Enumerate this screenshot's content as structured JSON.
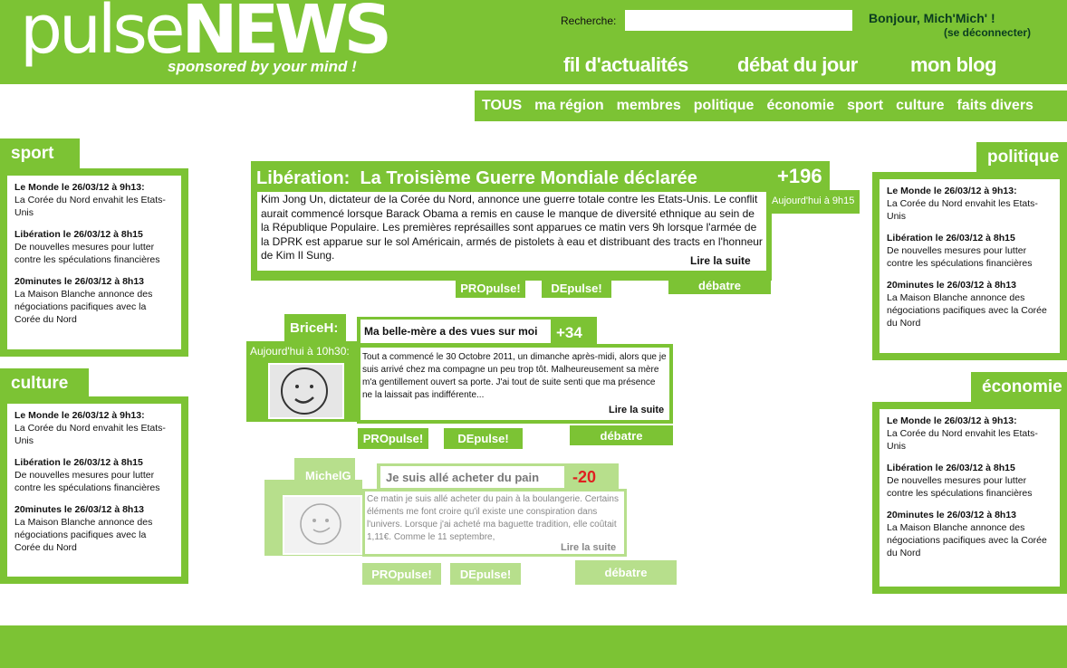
{
  "header": {
    "logo_light": "pulse",
    "logo_bold": "NEWS",
    "tagline": "sponsored by your mind !",
    "search_label": "Recherche:",
    "search_value": "",
    "greeting": "Bonjour, Mich'Mich' !",
    "logout": "(se déconnecter)"
  },
  "nav": [
    "fil d'actualités",
    "débat du jour",
    "mon blog"
  ],
  "categories": [
    "TOUS",
    "ma région",
    "membres",
    "politique",
    "économie",
    "sport",
    "culture",
    "faits divers"
  ],
  "panel_items": [
    {
      "source": "Le Monde le 26/03/12 à 9h13:",
      "text": "La Corée du Nord envahit les Etats-Unis"
    },
    {
      "source": "Libération le 26/03/12 à 8h15",
      "text": "De nouvelles mesures pour lutter contre les spéculations financières"
    },
    {
      "source": "20minutes le 26/03/12 à 8h13",
      "text": "La Maison Blanche annonce des négociations pacifiques avec la Corée du Nord"
    }
  ],
  "panels": {
    "sport": "sport",
    "culture": "culture",
    "politique": "politique",
    "economie": "économie"
  },
  "article1": {
    "source": "Libération:",
    "title": "La Troisième Guerre Mondiale déclarée",
    "score": "+196",
    "time": "Aujourd'hui à 9h15",
    "body": "Kim Jong Un, dictateur de la Corée du Nord, annonce une guerre totale contre les Etats-Unis. Le conflit aurait commencé lorsque Barack Obama a remis en cause le manque de diversité ethnique au sein de la République Populaire. Les premières représailles sont apparues ce matin vers 9h lorsque l'armée de la DPRK est apparue sur le sol Américain, armés de pistolets à eau et distribuant des tracts en l'honneur de Kim Il Sung.",
    "read_more": "Lire la suite"
  },
  "article2": {
    "author": "BriceH:",
    "time": "Aujourd'hui à 10h30:",
    "title": "Ma belle-mère a des vues sur moi",
    "score": "+34",
    "body": "Tout a commencé le 30 Octobre 2011, un dimanche après-midi, alors que je suis arrivé chez ma compagne un peu trop tôt. Malheureusement sa mère m'a gentillement ouvert sa porte. J'ai tout de suite senti que ma présence ne la laissait pas indifférente...",
    "read_more": "Lire la suite"
  },
  "article3": {
    "author": "MichelG",
    "title": "Je suis allé acheter du pain",
    "score": "-20",
    "body": "Ce matin je suis allé acheter du pain à la boulangerie. Certains éléments me font croire qu'il existe une conspiration dans l'univers. Lorsque j'ai acheté ma baguette tradition, elle coûtait 1,11€. Comme le 11 septembre,",
    "read_more": "Lire la suite"
  },
  "buttons": {
    "pro": "PROpulse!",
    "de": "DEpulse!",
    "debate": "débatre"
  },
  "colors": {
    "accent": "#7cc334",
    "faded": "#b7df8c",
    "negative": "#e02020"
  }
}
